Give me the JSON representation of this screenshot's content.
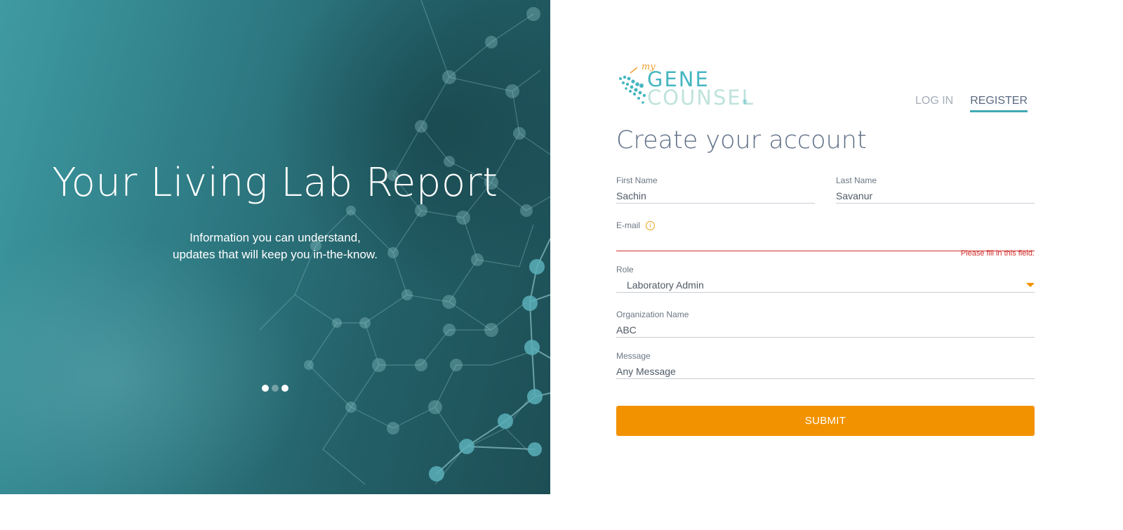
{
  "hero": {
    "title": "Your Living Lab Report",
    "subtitle_line1": "Information you can understand,",
    "subtitle_line2": "updates that will keep you in-the-know.",
    "slides": {
      "count": 3,
      "active_index": 1
    },
    "colors": {
      "base": "#2f7d86",
      "dark": "#1d4e55"
    }
  },
  "brand": {
    "my": "my",
    "line1": "GENE",
    "line2": "COUNSEL",
    "registered": "®",
    "colors": {
      "gene": "#45b6c0",
      "counsel": "#bfe3dc",
      "my": "#f0a030"
    }
  },
  "nav": {
    "login": "LOG IN",
    "register": "REGISTER",
    "active": "register"
  },
  "form": {
    "heading": "Create your account",
    "first_name": {
      "label": "First Name",
      "value": "Sachin"
    },
    "last_name": {
      "label": "Last Name",
      "value": "Savanur"
    },
    "email": {
      "label": "E-mail",
      "value": "",
      "info_icon": "info-icon",
      "error": "Please fill in this field."
    },
    "role": {
      "label": "Role",
      "value": "Laboratory Admin"
    },
    "organization": {
      "label": "Organization Name",
      "value": "ABC"
    },
    "message": {
      "label": "Message",
      "value": "Any Message"
    },
    "submit": "SUBMIT"
  },
  "colors": {
    "accent": "#f39200",
    "underline_active": "#3fa9b4",
    "error": "#d0312d",
    "select_text": "#3f9aa8"
  }
}
